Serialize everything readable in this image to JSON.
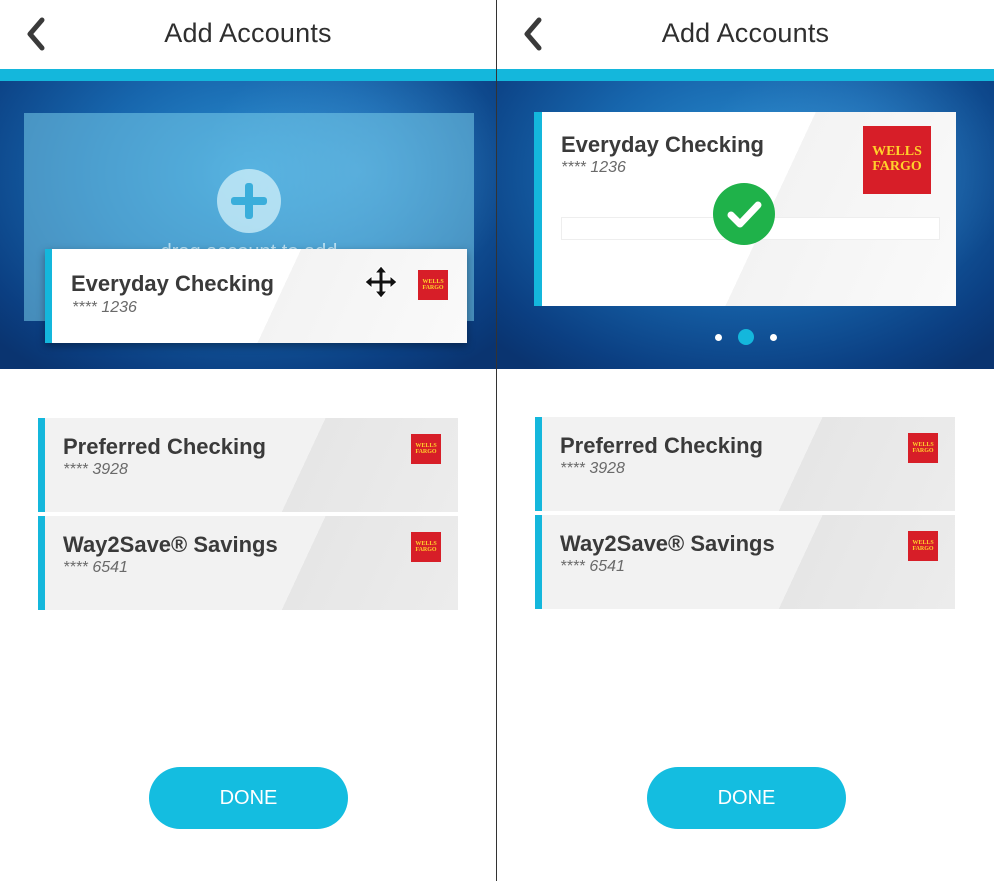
{
  "screens": [
    {
      "header": {
        "title": "Add Accounts"
      },
      "drop_zone": {
        "text": "drag account to add"
      },
      "dragging_card": {
        "name": "Everyday Checking",
        "number": "**** 1236",
        "bank_logo": "WELLS FARGO"
      },
      "accounts": [
        {
          "name": "Preferred Checking",
          "number": "**** 3928",
          "bank_logo": "WELLS FARGO"
        },
        {
          "name": "Way2Save® Savings",
          "number": "**** 6541",
          "bank_logo": "WELLS FARGO"
        }
      ],
      "done_label": "DONE"
    },
    {
      "header": {
        "title": "Add Accounts"
      },
      "added_card": {
        "name": "Everyday Checking",
        "number": "**** 1236",
        "bank_logo_line1": "WELLS",
        "bank_logo_line2": "FARGO"
      },
      "carousel": {
        "page_count": 3,
        "active_index": 1
      },
      "accounts": [
        {
          "name": "Preferred Checking",
          "number": "**** 3928",
          "bank_logo": "WELLS FARGO"
        },
        {
          "name": "Way2Save® Savings",
          "number": "**** 6541",
          "bank_logo": "WELLS FARGO"
        }
      ],
      "done_label": "DONE"
    }
  ],
  "colors": {
    "accent": "#14b7dc",
    "button": "#14bde0",
    "success": "#1fb24a",
    "bank_red": "#d71e28",
    "bank_gold": "#ffd12b"
  },
  "icons": {
    "back": "chevron-left-icon",
    "move": "move-icon",
    "add": "plus-circle-icon",
    "success": "check-circle-icon"
  }
}
